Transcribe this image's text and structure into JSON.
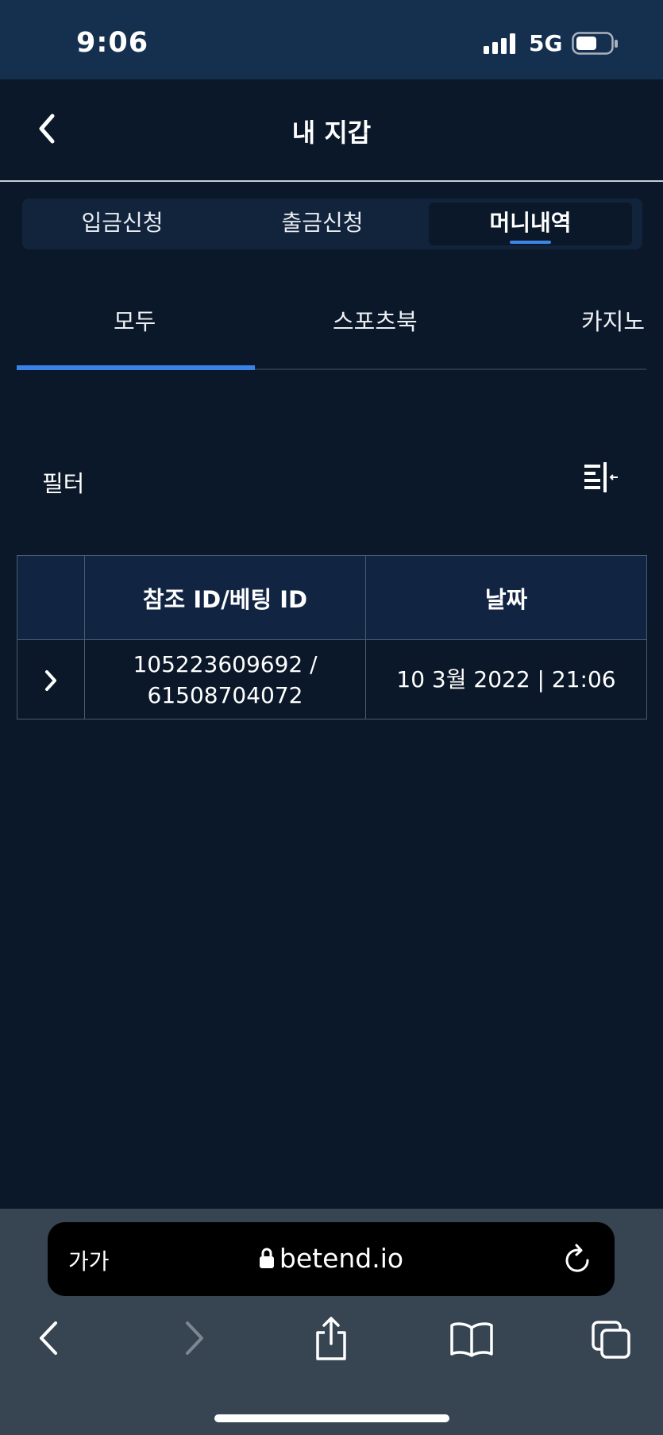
{
  "status": {
    "time": "9:06",
    "network": "5G"
  },
  "header": {
    "title": "내 지갑"
  },
  "segment_tabs": [
    {
      "label": "입금신청"
    },
    {
      "label": "출금신청"
    },
    {
      "label": "머니내역"
    }
  ],
  "sub_tabs": [
    {
      "label": "모두"
    },
    {
      "label": "스포츠북"
    },
    {
      "label": "카지노"
    }
  ],
  "filter": {
    "label": "필터"
  },
  "table": {
    "headers": [
      "",
      "참조 ID/베팅 ID",
      "날짜"
    ],
    "rows": [
      {
        "ref_line1": "105223609692 /",
        "ref_line2": "61508704072",
        "date": "10 3월 2022 | 21:06"
      }
    ]
  },
  "browser": {
    "text_size": "가가",
    "url": "betend.io"
  },
  "colors": {
    "accent": "#3b82e6",
    "background": "#0b1829",
    "table_header": "#112543"
  }
}
